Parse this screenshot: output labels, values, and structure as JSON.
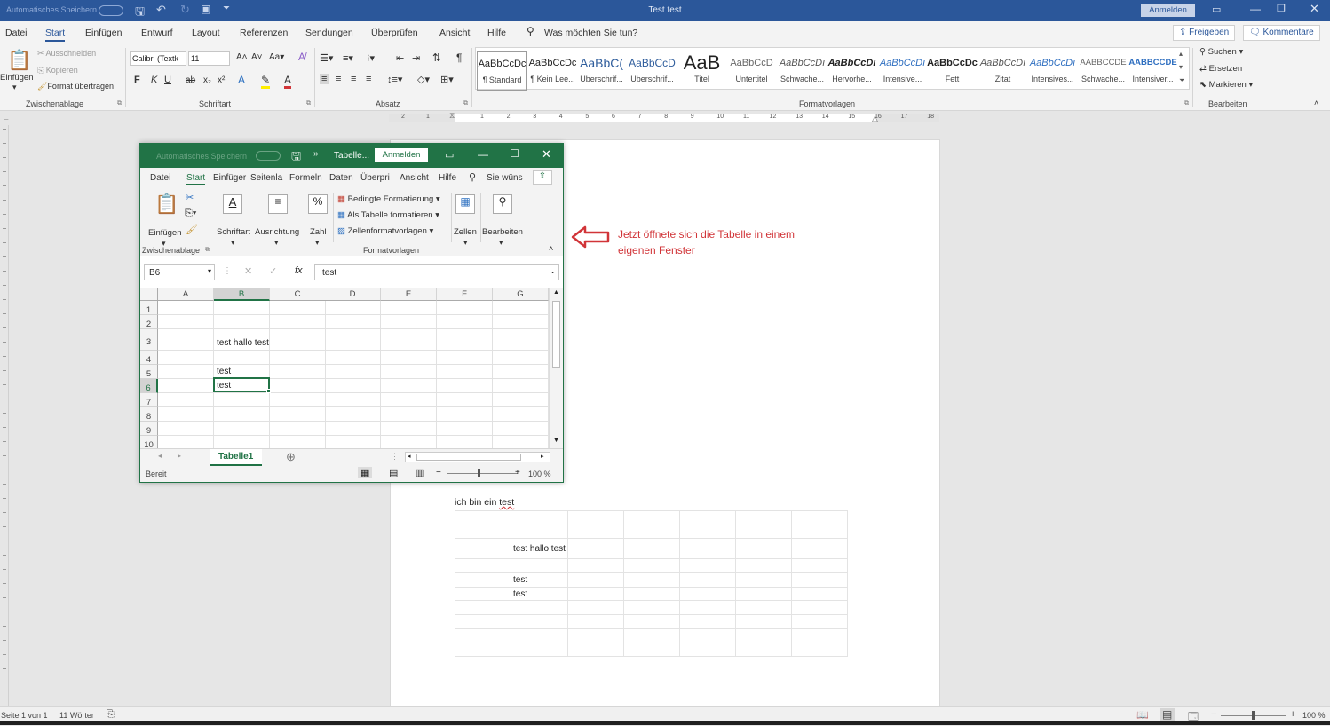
{
  "word": {
    "qat": {
      "autosave": "Automatisches Speichern"
    },
    "title": "Test test",
    "signin": "Anmelden",
    "tabs": [
      "Datei",
      "Start",
      "Einfügen",
      "Entwurf",
      "Layout",
      "Referenzen",
      "Sendungen",
      "Überprüfen",
      "Ansicht",
      "Hilfe"
    ],
    "tell_me": "Was möchten Sie tun?",
    "share": "Freigeben",
    "comments": "Kommentare",
    "clipboard": {
      "paste": "Einfügen",
      "cut": "Ausschneiden",
      "copy": "Kopieren",
      "format_painter": "Format übertragen",
      "label": "Zwischenablage"
    },
    "font": {
      "name": "Calibri (Textk",
      "size": "11",
      "label": "Schriftart",
      "bold": "F",
      "italic": "K",
      "underline": "U",
      "strike": "ab",
      "sub": "x₂",
      "sup": "x²",
      "effects": "A",
      "color": "A"
    },
    "paragraph": {
      "label": "Absatz",
      "pilcrow": "¶"
    },
    "styles": {
      "label": "Formatvorlagen",
      "items": [
        {
          "preview": "AaBbCcDc",
          "name": "¶ Standard"
        },
        {
          "preview": "AaBbCcDc",
          "name": "¶ Kein Lee..."
        },
        {
          "preview": "AaBbC(",
          "name": "Überschrif..."
        },
        {
          "preview": "AaBbCcD",
          "name": "Überschrif..."
        },
        {
          "preview": "AaB",
          "name": "Titel"
        },
        {
          "preview": "AaBbCcD",
          "name": "Untertitel"
        },
        {
          "preview": "AaBbCcDı",
          "name": "Schwache..."
        },
        {
          "preview": "AaBbCcDı",
          "name": "Hervorhe..."
        },
        {
          "preview": "AaBbCcDı",
          "name": "Intensive..."
        },
        {
          "preview": "AaBbCcDc",
          "name": "Fett"
        },
        {
          "preview": "AaBbCcDı",
          "name": "Zitat"
        },
        {
          "preview": "AaBbCcDı",
          "name": "Intensives..."
        },
        {
          "preview": "AABBCCDE",
          "name": "Schwache..."
        },
        {
          "preview": "AABBCCDE",
          "name": "Intensiver..."
        }
      ]
    },
    "editing": {
      "label": "Bearbeiten",
      "find": "Suchen",
      "replace": "Ersetzen",
      "select": "Markieren"
    },
    "ruler": [
      "2",
      "1",
      "1",
      "2",
      "3",
      "4",
      "5",
      "6",
      "7",
      "8",
      "9",
      "10",
      "11",
      "12",
      "13",
      "14",
      "15",
      "16",
      "17",
      "18"
    ],
    "document": {
      "heading": "ich bin ein ",
      "heading_word": "test",
      "table": [
        [
          "",
          "",
          "",
          "",
          "",
          "",
          ""
        ],
        [
          "",
          "",
          "",
          "",
          "",
          "",
          ""
        ],
        [
          "",
          "test hallo test",
          "",
          "",
          "",
          "",
          ""
        ],
        [
          "",
          "",
          "",
          "",
          "",
          "",
          ""
        ],
        [
          "",
          "test",
          "",
          "",
          "",
          "",
          ""
        ],
        [
          "",
          "test",
          "",
          "",
          "",
          "",
          ""
        ],
        [
          "",
          "",
          "",
          "",
          "",
          "",
          ""
        ],
        [
          "",
          "",
          "",
          "",
          "",
          "",
          ""
        ],
        [
          "",
          "",
          "",
          "",
          "",
          "",
          ""
        ],
        [
          "",
          "",
          "",
          "",
          "",
          "",
          ""
        ]
      ]
    },
    "annotation": {
      "line1": "Jetzt öffnete sich die Tabelle in einem",
      "line2": "eigenen Fenster",
      "color": "#d13438"
    },
    "status": {
      "page": "Seite 1 von 1",
      "words": "11 Wörter",
      "zoom": "100 %"
    }
  },
  "excel": {
    "autosave": "Automatisches Speichern",
    "title": "Tabelle...",
    "signin": "Anmelden",
    "tabs": [
      "Datei",
      "Start",
      "Einfüger",
      "Seitenla",
      "Formeln",
      "Daten",
      "Überpri",
      "Ansicht",
      "Hilfe"
    ],
    "tell_me": "Sie wüns",
    "ribbon": {
      "paste": "Einfügen",
      "font": "Schriftart",
      "align": "Ausrichtung",
      "number": "Zahl",
      "cond": "Bedingte Formatierung",
      "as_table": "Als Tabelle formatieren",
      "cell_styles": "Zellenformatvorlagen",
      "cells": "Zellen",
      "edit": "Bearbeiten",
      "clipboard_label": "Zwischenablage",
      "styles_label": "Formatvorlagen"
    },
    "namebox": "B6",
    "formula": "test",
    "columns": [
      "A",
      "B",
      "C",
      "D",
      "E",
      "F",
      "G"
    ],
    "rows": [
      "1",
      "2",
      "3",
      "4",
      "5",
      "6",
      "7",
      "8",
      "9",
      "10"
    ],
    "cells": {
      "B3": "test hallo test",
      "B5": "test",
      "B6": "test"
    },
    "sheet": "Tabelle1",
    "status": {
      "ready": "Bereit",
      "zoom": "100 %"
    },
    "accent": "#217346"
  }
}
